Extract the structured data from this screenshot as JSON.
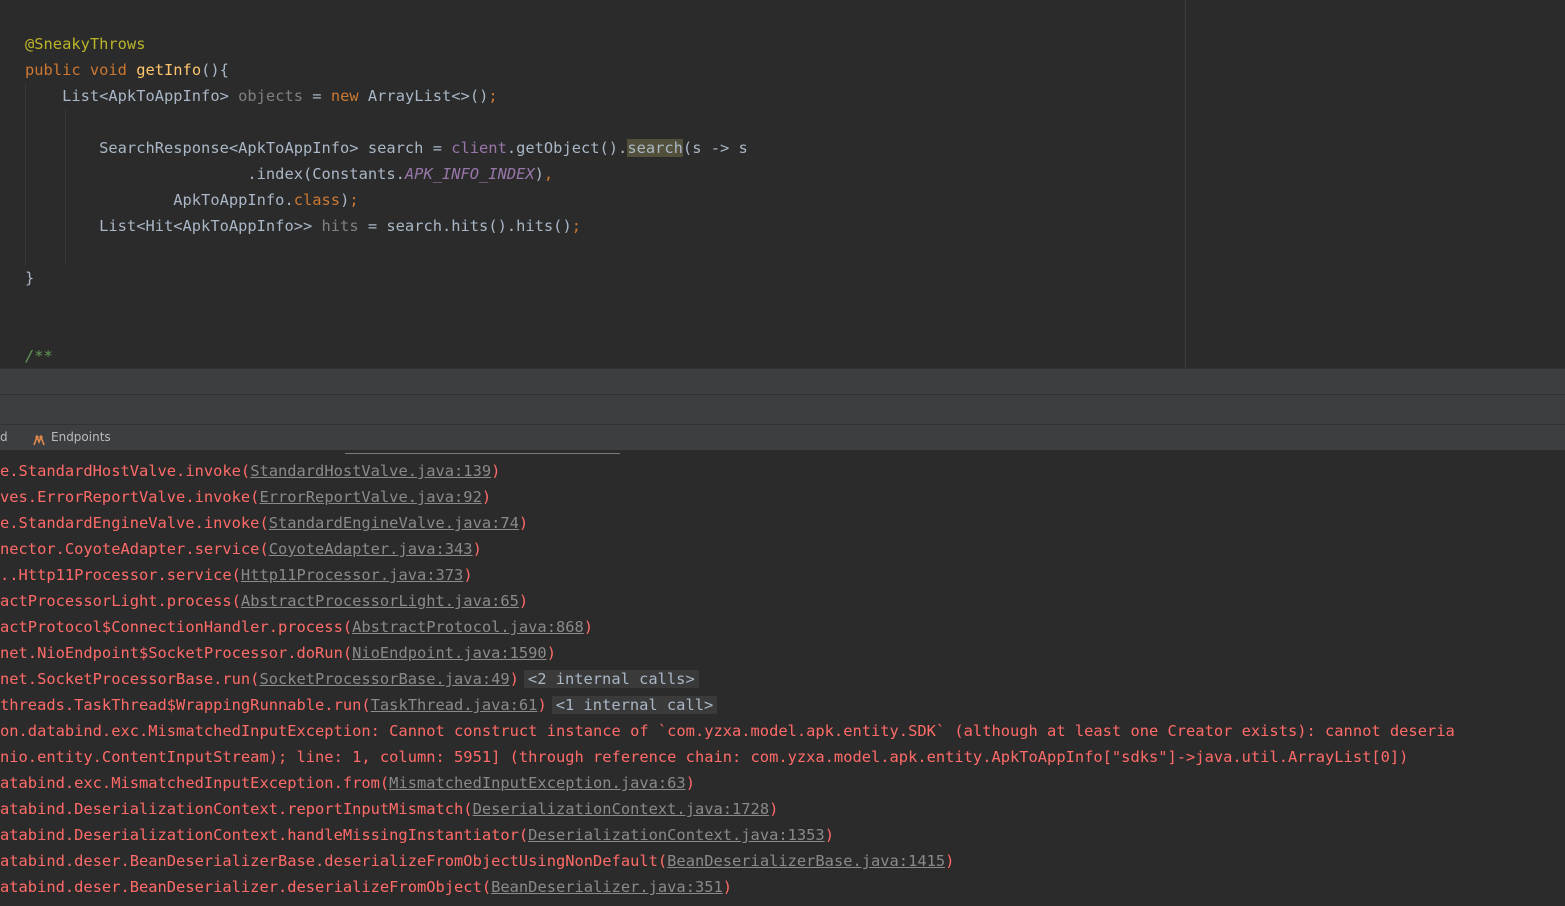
{
  "editor": {
    "lines": [
      [
        {
          "t": "@SneakyThrows",
          "c": "ann"
        }
      ],
      [
        {
          "t": "public ",
          "c": "kw"
        },
        {
          "t": "void ",
          "c": "kw"
        },
        {
          "t": "getInfo",
          "c": "fn"
        },
        {
          "t": "(){",
          "c": ""
        }
      ],
      [
        {
          "t": "    List<ApkToAppInfo> ",
          "c": ""
        },
        {
          "t": "objects",
          "c": "unused"
        },
        {
          "t": " = ",
          "c": ""
        },
        {
          "t": "new ",
          "c": "kw"
        },
        {
          "t": "ArrayList<>()",
          "c": ""
        },
        {
          "t": ";",
          "c": "semi"
        }
      ],
      [],
      [
        {
          "t": "        SearchResponse<ApkToAppInfo> search = ",
          "c": ""
        },
        {
          "t": "client",
          "c": "field"
        },
        {
          "t": ".getObject().",
          "c": ""
        },
        {
          "t": "search",
          "c": "hl"
        },
        {
          "t": "(s -> s",
          "c": ""
        }
      ],
      [
        {
          "t": "                        .index(Constants.",
          "c": ""
        },
        {
          "t": "APK_INFO_INDEX",
          "c": "constf"
        },
        {
          "t": ")",
          "c": ""
        },
        {
          "t": ",",
          "c": "semi"
        }
      ],
      [
        {
          "t": "                ApkToAppInfo.",
          "c": ""
        },
        {
          "t": "class",
          "c": "kw"
        },
        {
          "t": ")",
          "c": ""
        },
        {
          "t": ";",
          "c": "semi"
        }
      ],
      [
        {
          "t": "        List<Hit<ApkToAppInfo>> ",
          "c": ""
        },
        {
          "t": "hits",
          "c": "unused"
        },
        {
          "t": " = search.hits().hits()",
          "c": ""
        },
        {
          "t": ";",
          "c": "semi"
        }
      ],
      [],
      [
        {
          "t": "}",
          "c": ""
        }
      ],
      [],
      [],
      [
        {
          "t": "/**",
          "c": "doc"
        }
      ]
    ]
  },
  "toolbar": {
    "left_fragment": "d",
    "endpoints_label": "Endpoints",
    "endpoints_icon": "endpoints-icon"
  },
  "console": {
    "lines": [
      [
        {
          "t": "e.StandardHostValve.invoke(",
          "c": ""
        },
        {
          "t": "StandardHostValve.java:139",
          "c": "link"
        },
        {
          "t": ")",
          "c": ""
        }
      ],
      [
        {
          "t": "ves.ErrorReportValve.invoke(",
          "c": ""
        },
        {
          "t": "ErrorReportValve.java:92",
          "c": "link"
        },
        {
          "t": ")",
          "c": ""
        }
      ],
      [
        {
          "t": "e.StandardEngineValve.invoke(",
          "c": ""
        },
        {
          "t": "StandardEngineValve.java:74",
          "c": "link"
        },
        {
          "t": ")",
          "c": ""
        }
      ],
      [
        {
          "t": "nector.CoyoteAdapter.service(",
          "c": ""
        },
        {
          "t": "CoyoteAdapter.java:343",
          "c": "link"
        },
        {
          "t": ")",
          "c": ""
        }
      ],
      [
        {
          "t": "..Http11Processor.service(",
          "c": ""
        },
        {
          "t": "Http11Processor.java:373",
          "c": "link"
        },
        {
          "t": ")",
          "c": ""
        }
      ],
      [
        {
          "t": "actProcessorLight.process(",
          "c": ""
        },
        {
          "t": "AbstractProcessorLight.java:65",
          "c": "link"
        },
        {
          "t": ")",
          "c": ""
        }
      ],
      [
        {
          "t": "actProtocol$ConnectionHandler.process(",
          "c": ""
        },
        {
          "t": "AbstractProtocol.java:868",
          "c": "link"
        },
        {
          "t": ")",
          "c": ""
        }
      ],
      [
        {
          "t": "net.NioEndpoint$SocketProcessor.doRun(",
          "c": ""
        },
        {
          "t": "NioEndpoint.java:1590",
          "c": "link"
        },
        {
          "t": ")",
          "c": ""
        }
      ],
      [
        {
          "t": "net.SocketProcessorBase.run(",
          "c": ""
        },
        {
          "t": "SocketProcessorBase.java:49",
          "c": "link"
        },
        {
          "t": ")",
          "c": ""
        },
        {
          "t": "<2 internal calls>",
          "c": "internal"
        }
      ],
      [
        {
          "t": "threads.TaskThread$WrappingRunnable.run(",
          "c": ""
        },
        {
          "t": "TaskThread.java:61",
          "c": "link"
        },
        {
          "t": ")",
          "c": ""
        },
        {
          "t": "<1 internal call>",
          "c": "internal"
        }
      ],
      [
        {
          "t": "on.databind.exc.MismatchedInputException: Cannot construct instance of `com.yzxa.model.apk.entity.SDK` (although at least one Creator exists): cannot deseria",
          "c": ""
        }
      ],
      [
        {
          "t": "nio.entity.ContentInputStream); line: 1, column: 5951] (through reference chain: com.yzxa.model.apk.entity.ApkToAppInfo[\"sdks\"]->java.util.ArrayList[0])",
          "c": ""
        }
      ],
      [
        {
          "t": "atabind.exc.MismatchedInputException.from(",
          "c": ""
        },
        {
          "t": "MismatchedInputException.java:63",
          "c": "link"
        },
        {
          "t": ")",
          "c": ""
        }
      ],
      [
        {
          "t": "atabind.DeserializationContext.reportInputMismatch(",
          "c": ""
        },
        {
          "t": "DeserializationContext.java:1728",
          "c": "link"
        },
        {
          "t": ")",
          "c": ""
        }
      ],
      [
        {
          "t": "atabind.DeserializationContext.handleMissingInstantiator(",
          "c": ""
        },
        {
          "t": "DeserializationContext.java:1353",
          "c": "link"
        },
        {
          "t": ")",
          "c": ""
        }
      ],
      [
        {
          "t": "atabind.deser.BeanDeserializerBase.deserializeFromObjectUsingNonDefault(",
          "c": ""
        },
        {
          "t": "BeanDeserializerBase.java:1415",
          "c": "link"
        },
        {
          "t": ")",
          "c": ""
        }
      ],
      [
        {
          "t": "atabind.deser.BeanDeserializer.deserializeFromObject(",
          "c": ""
        },
        {
          "t": "BeanDeserializer.java:351",
          "c": "link"
        },
        {
          "t": ")",
          "c": ""
        }
      ]
    ]
  }
}
